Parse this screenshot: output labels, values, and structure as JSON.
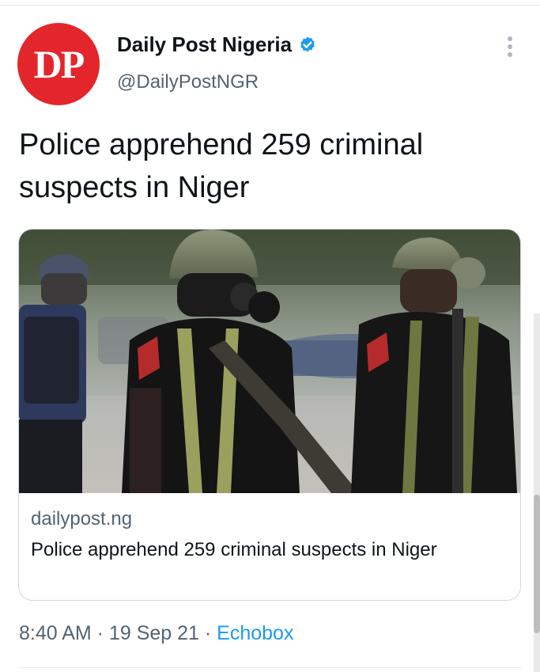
{
  "author": {
    "avatar_text": "DP",
    "display_name": "Daily Post Nigeria",
    "handle": "@DailyPostNGR",
    "verified": true,
    "brand_color": "#e3262b"
  },
  "tweet": {
    "text": "Police apprehend 259 criminal suspects in Niger"
  },
  "link_card": {
    "image_description": "Armed police officers in helmets and gas mask holding rifles on a street",
    "domain": "dailypost.ng",
    "title": "Police apprehend 259 criminal suspects in Niger"
  },
  "meta": {
    "time": "8:40 AM",
    "separator": " · ",
    "date": "19 Sep 21",
    "source": "Echobox"
  },
  "icons": {
    "verified": "verified-badge-icon",
    "more": "more-options-icon"
  },
  "colors": {
    "text": "#0f1419",
    "secondary": "#536471",
    "link": "#1d9bf0",
    "verified": "#1d9bf0",
    "border": "#cfd9de"
  }
}
